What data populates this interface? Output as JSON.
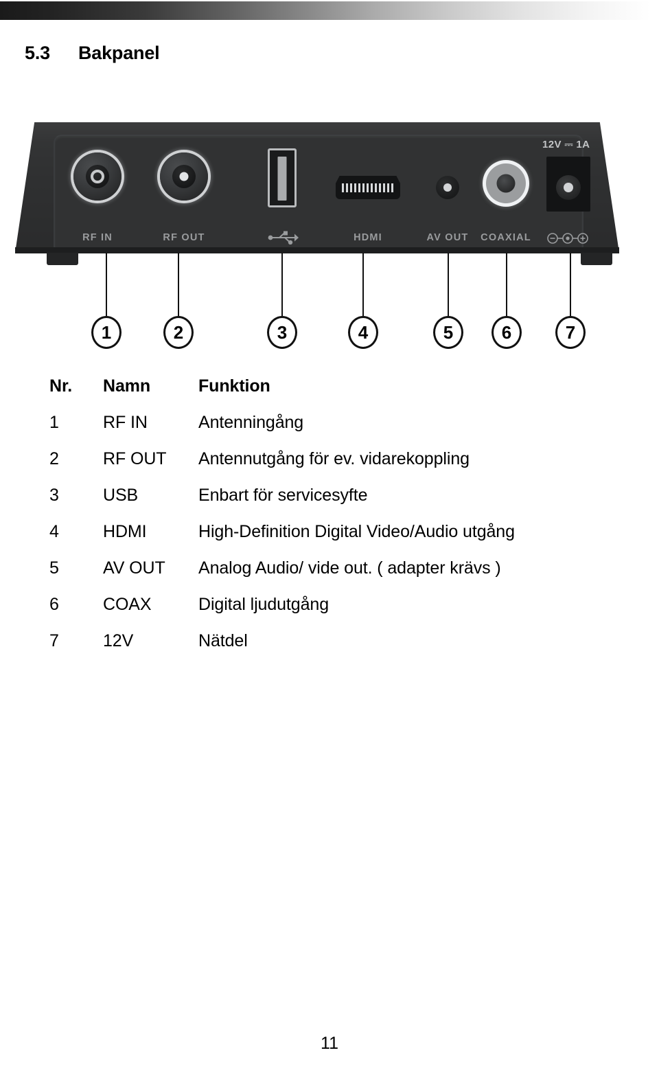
{
  "document": {
    "section_number": "5.3",
    "section_title": "Bakpanel",
    "page_number": "11"
  },
  "figure": {
    "caption_alt": "back panel of set-top box",
    "port_labels": {
      "rf_in": "RF IN",
      "rf_out": "RF OUT",
      "usb": "usb-icon",
      "hdmi": "HDMI",
      "av_out": "AV OUT",
      "coaxial": "COAXIAL",
      "power_polarity": "polarity-icon"
    },
    "power_rating": "12V ⎓ 1A",
    "callouts": [
      "1",
      "2",
      "3",
      "4",
      "5",
      "6",
      "7"
    ],
    "colors": {
      "chassis": "#2f3031",
      "panel": "#313233",
      "port_label": "#9a9c9e",
      "metal_ring": "#cfd1d3"
    }
  },
  "table": {
    "headers": {
      "nr": "Nr.",
      "name": "Namn",
      "function": "Funktion"
    },
    "rows": [
      {
        "nr": "1",
        "name": "RF IN",
        "function": "Antenningång"
      },
      {
        "nr": "2",
        "name": "RF OUT",
        "function": "Antennutgång för ev. vidarekoppling"
      },
      {
        "nr": "3",
        "name": "USB",
        "function": "Enbart för servicesyfte"
      },
      {
        "nr": "4",
        "name": "HDMI",
        "function": "High-Definition Digital Video/Audio utgång"
      },
      {
        "nr": "5",
        "name": "AV OUT",
        "function": "Analog Audio/ vide out. ( adapter krävs )"
      },
      {
        "nr": "6",
        "name": "COAX",
        "function": "Digital ljudutgång"
      },
      {
        "nr": "7",
        "name": "12V",
        "function": "Nätdel"
      }
    ]
  }
}
